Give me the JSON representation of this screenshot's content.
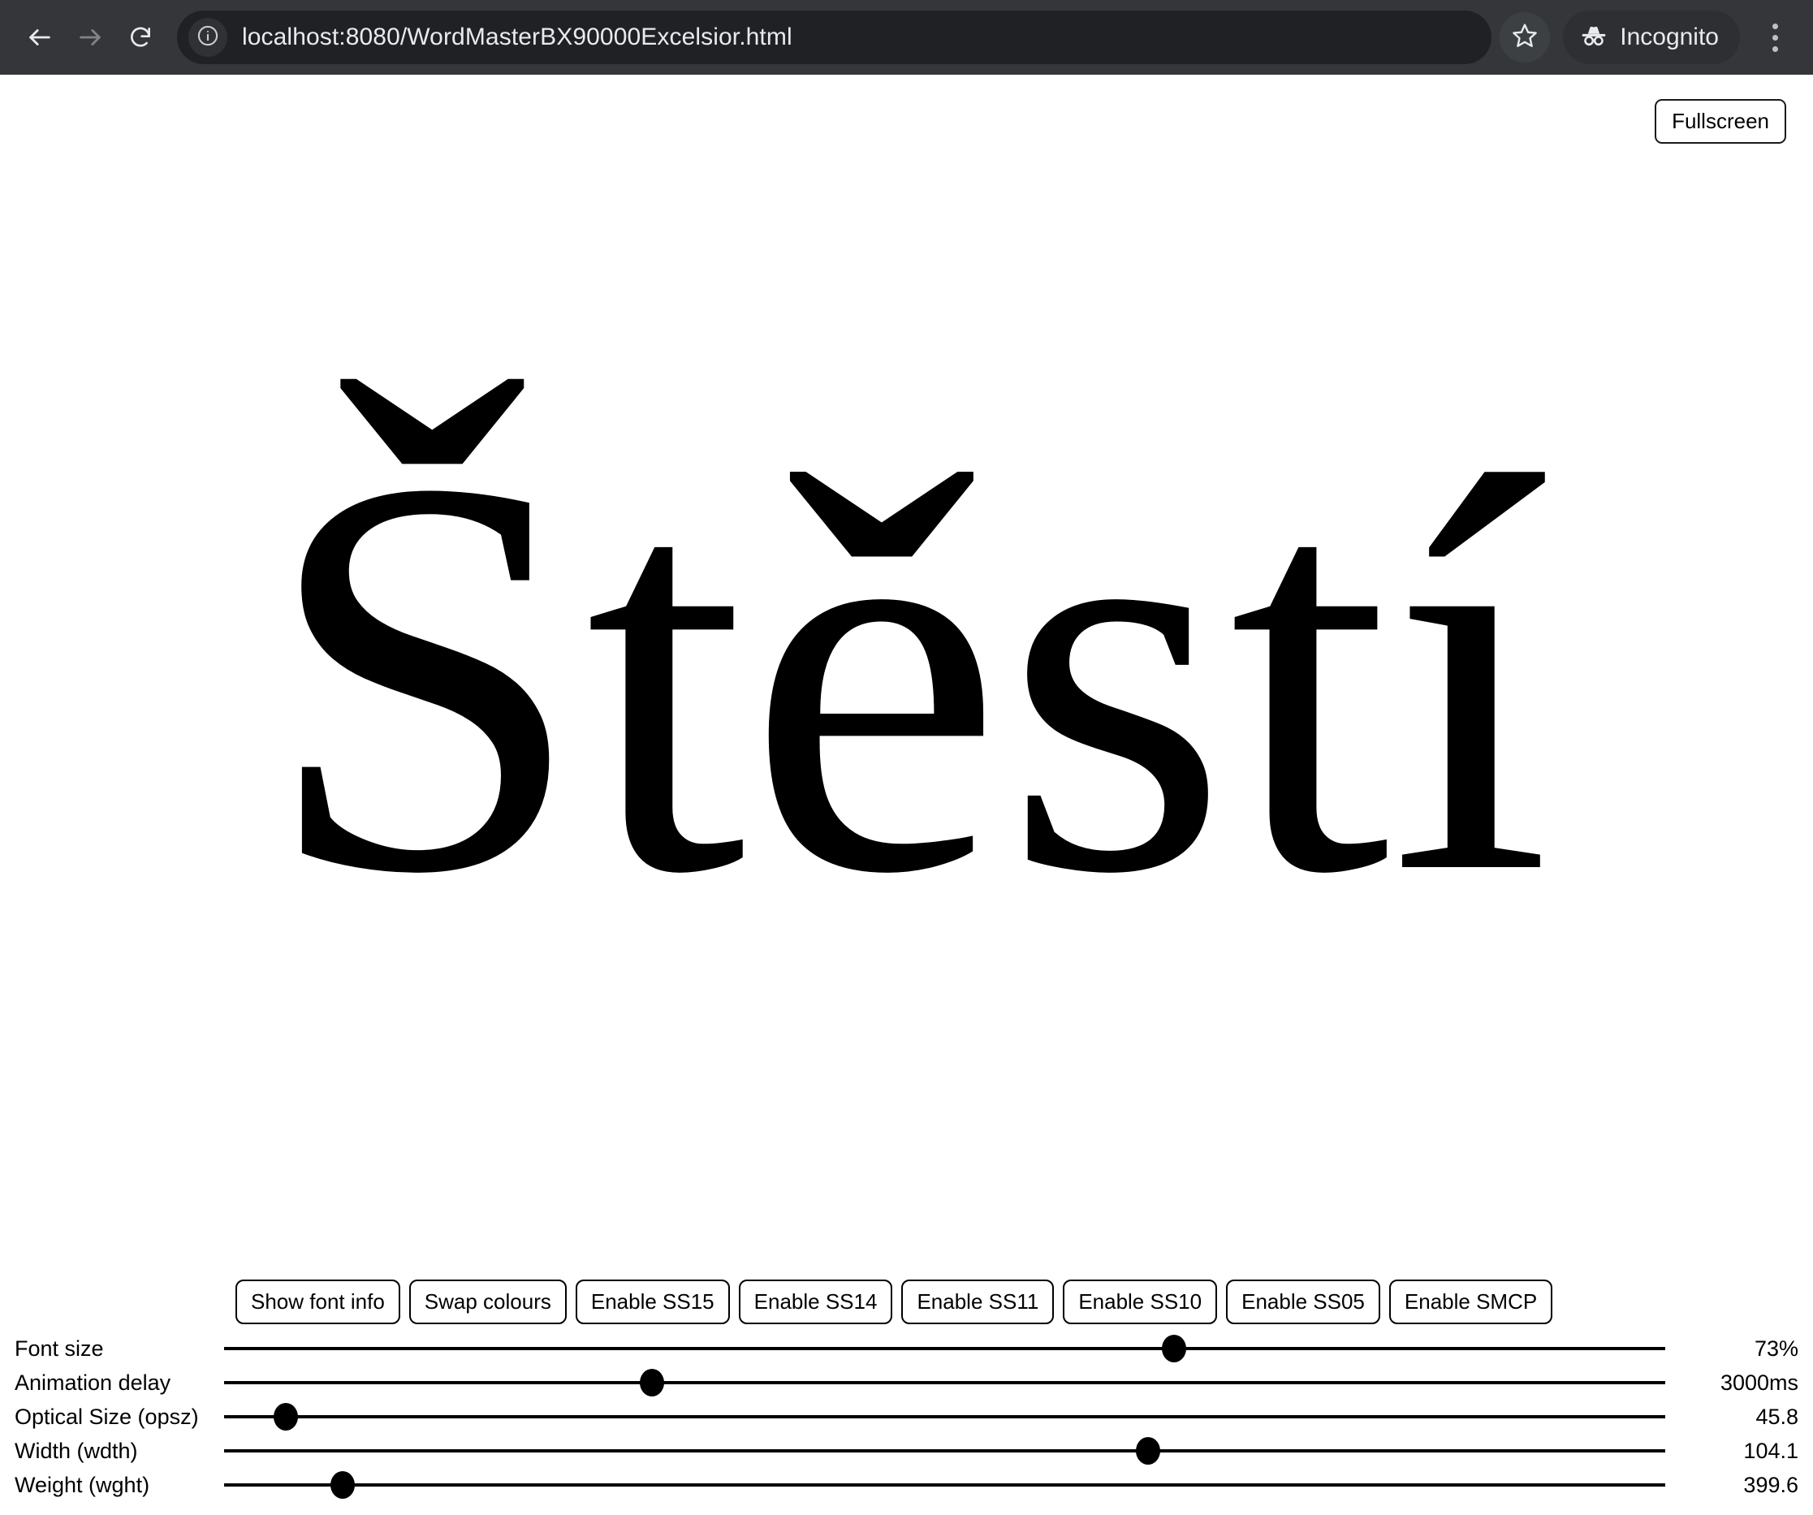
{
  "browser": {
    "url": "localhost:8080/WordMasterBX90000Excelsior.html",
    "back_icon": "back-arrow-icon",
    "forward_icon": "forward-arrow-icon",
    "reload_icon": "reload-icon",
    "info_icon": "site-info-icon",
    "bookmark_icon": "star-icon",
    "incognito_label": "Incognito",
    "incognito_icon": "incognito-icon",
    "menu_icon": "kebab-menu-icon",
    "toolbar_color": "#35363a",
    "omnibox_color": "#202124",
    "text_color": "#e8eaed"
  },
  "page": {
    "fullscreen_label": "Fullscreen",
    "display_word": "Štěstí",
    "background_color": "#ffffff",
    "foreground_color": "#000000"
  },
  "buttons": [
    {
      "label": "Show font info",
      "name": "show-font-info-button"
    },
    {
      "label": "Swap colours",
      "name": "swap-colours-button"
    },
    {
      "label": "Enable SS15",
      "name": "enable-ss15-button"
    },
    {
      "label": "Enable SS14",
      "name": "enable-ss14-button"
    },
    {
      "label": "Enable SS11",
      "name": "enable-ss11-button"
    },
    {
      "label": "Enable SS10",
      "name": "enable-ss10-button"
    },
    {
      "label": "Enable SS05",
      "name": "enable-ss05-button"
    },
    {
      "label": "Enable SMCP",
      "name": "enable-smcp-button"
    }
  ],
  "sliders": [
    {
      "label": "Font size",
      "value": "73%",
      "percent": 65.9
    },
    {
      "label": "Animation delay",
      "value": "3000ms",
      "percent": 29.7
    },
    {
      "label": "Optical Size (opsz)",
      "value": "45.8",
      "percent": 4.3
    },
    {
      "label": "Width (wdth)",
      "value": "104.1",
      "percent": 64.1
    },
    {
      "label": "Weight (wght)",
      "value": "399.6",
      "percent": 8.2
    }
  ]
}
